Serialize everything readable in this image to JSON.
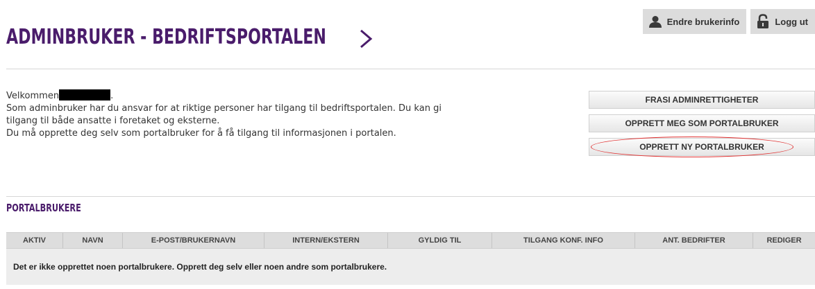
{
  "header": {
    "title": "ADMINBRUKER - BEDRIFTSPORTALEN",
    "edit_user_label": "Endre brukerinfo",
    "logout_label": "Logg ut"
  },
  "welcome": {
    "greeting": "Velkommen",
    "greeting_suffix": ".",
    "line1": "Som adminbruker har du ansvar for at riktige personer har tilgang til bedriftsportalen. Du kan gi",
    "line2": "tilgang til både ansatte i foretaket og eksterne.",
    "line3": "Du må opprette deg selv som portalbruker for å få tilgang til informasjonen i portalen."
  },
  "actions": {
    "renounce_label": "FRASI ADMINRETTIGHETER",
    "create_me_label": "OPPRETT MEG SOM PORTALBRUKER",
    "create_new_label": "OPPRETT NY PORTALBRUKER"
  },
  "portal_users": {
    "section_title": "PORTALBRUKERE",
    "columns": [
      "AKTIV",
      "NAVN",
      "E-POST/BRUKERNAVN",
      "INTERN/EKSTERN",
      "GYLDIG TIL",
      "TILGANG KONF. INFO",
      "ANT. BEDRIFTER",
      "REDIGER"
    ],
    "empty_message": "Det er ikke opprettet noen portalbrukere. Opprett deg selv eller noen andre som portalbrukere."
  },
  "colors": {
    "brand_purple": "#4a1c6b",
    "highlight_red": "#e03030",
    "button_gray": "#dcdcdc"
  },
  "icons": {
    "edit_user": "user-icon",
    "logout": "padlock-icon",
    "title": "chevron-right-icon"
  }
}
